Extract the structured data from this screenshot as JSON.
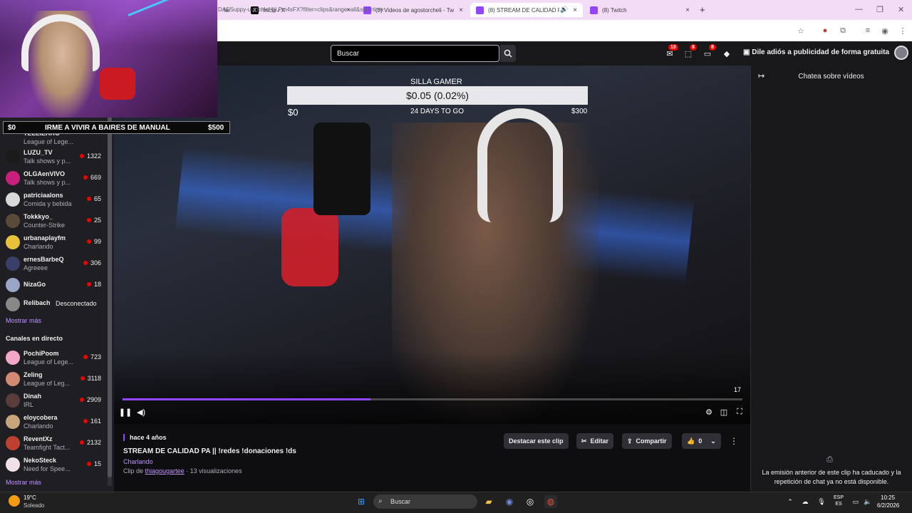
{
  "browser": {
    "tabs": [
      {
        "title": "fer",
        "icon": "twitch-icon",
        "active": false
      },
      {
        "title": "Inicio / X",
        "icon": "x-icon",
        "active": false
      },
      {
        "title": "(8) Videos de agostorcheli - Tw",
        "icon": "twitch-icon",
        "active": false
      },
      {
        "title": "(8) STREAM DE CALIDAD P/",
        "icon": "twitch-icon",
        "active": true
      },
      {
        "title": "(8) Twitch",
        "icon": "twitch-icon",
        "active": false
      }
    ],
    "url": "DAESuppy-uuHoHeHjjl.Pm4sFX?filter=clips&range=all&sort=time",
    "new_tab": "+",
    "close_glyph": "×"
  },
  "topnav": {
    "search_placeholder": "Buscar",
    "badges": {
      "inbox": "18",
      "drops": "8",
      "notifications": "8"
    },
    "adfree_label": "Dile adiós a publicidad de forma gratuita"
  },
  "overlay": {
    "goal_bar_small": {
      "start": "$0",
      "title": "IRME A VIVIR A BAIRES DE MANUAL",
      "end": "$500"
    },
    "goal_bar_main": {
      "label": "SILLA GAMER",
      "value": "$0.05 (0.02%)",
      "start": "$0",
      "days": "24 DAYS TO GO",
      "end": "$300"
    }
  },
  "sidebar": {
    "followed": [
      {
        "name": "LUZU_TV",
        "game": "Talk shows y p...",
        "viewers": "1322",
        "color": "#1a1a1a"
      },
      {
        "name": "OLGAenVIVO",
        "game": "Talk shows y p...",
        "viewers": "669",
        "color": "#c8207c"
      },
      {
        "name": "patriciaalons",
        "game": "Comida y bebida",
        "viewers": "65",
        "color": "#d9d9d9"
      },
      {
        "name": "Tokkkyo_",
        "game": "Counter-Strike",
        "viewers": "25",
        "color": "#5a4a3a"
      },
      {
        "name": "urbanaplayfm",
        "game": "Charlando",
        "viewers": "99",
        "color": "#e8c23a"
      },
      {
        "name": "ernesBarbeQ",
        "game": "Agreeee",
        "viewers": "306",
        "color": "#3a3f6a"
      },
      {
        "name": "NizaGo",
        "game": "",
        "viewers": "18",
        "color": "#9aa6c8"
      }
    ],
    "offline": {
      "name": "Relibach",
      "status": "Desconectado"
    },
    "show_more_1": "Mostrar más",
    "live_section_title": "Canales en directo",
    "live": [
      {
        "name": "PochiPoom",
        "game": "League of Lege...",
        "viewers": "723",
        "color": "#f2a7c8"
      },
      {
        "name": "Zeling",
        "game": "League of Leg...",
        "viewers": "3118",
        "color": "#d28a74"
      },
      {
        "name": "Dinah",
        "game": "IRL",
        "viewers": "2909",
        "color": "#5b3c3c"
      },
      {
        "name": "eloycobera",
        "game": "Charlando",
        "viewers": "161",
        "color": "#c9a57a"
      },
      {
        "name": "ReventXz",
        "game": "Teamfight Tact...",
        "viewers": "2132",
        "color": "#c04030"
      },
      {
        "name": "NekoSteck",
        "game": "Need for Spee...",
        "viewers": "15",
        "color": "#f0e0e8"
      }
    ],
    "partial_top": {
      "name": "TELLIERRO",
      "game": "League of Lege..."
    },
    "show_more_2": "Mostrar más"
  },
  "player": {
    "progress": 0.4,
    "time_label": "17"
  },
  "clip": {
    "age": "hace 4 años",
    "title": "STREAM DE CALIDAD PA || !redes !donaciones !ds",
    "category": "Charlando",
    "by_prefix": "Clip de",
    "by_user": "thiagougartee",
    "views": "· 13 visualizaciones",
    "actions": {
      "highlight": "Destacar este clip",
      "edit": "Editar",
      "share": "Compartir",
      "likes": "0"
    }
  },
  "chat": {
    "title": "Chatea sobre vídeos",
    "expired_message": "La emisión anterior de este clip ha caducado y la repetición de chat ya no está disponible."
  },
  "taskbar": {
    "weather_temp": "19°C",
    "weather_desc": "Soleado",
    "search_label": "Buscar",
    "lang_1": "ESP",
    "lang_2": "ES",
    "time": "10:25",
    "date": "6/2/2026"
  }
}
